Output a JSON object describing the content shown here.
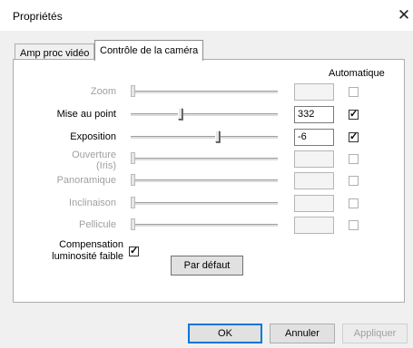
{
  "window": {
    "title": "Propriétés",
    "close_glyph": "✕"
  },
  "tabs": [
    {
      "label": "Amp proc vidéo",
      "active": false
    },
    {
      "label": "Contrôle de la caméra",
      "active": true
    }
  ],
  "auto_header": "Automatique",
  "rows": [
    {
      "label": "Zoom",
      "enabled": false,
      "value": "",
      "slider_fraction": 0.0,
      "auto_checked": false
    },
    {
      "label": "Mise au point",
      "enabled": true,
      "value": "332",
      "slider_fraction": 0.33,
      "auto_checked": true
    },
    {
      "label": "Exposition",
      "enabled": true,
      "value": "-6",
      "slider_fraction": 0.59,
      "auto_checked": true
    },
    {
      "label": "Ouverture\n(Iris)",
      "enabled": false,
      "value": "",
      "slider_fraction": 0.0,
      "auto_checked": false
    },
    {
      "label": "Panoramique",
      "enabled": false,
      "value": "",
      "slider_fraction": 0.0,
      "auto_checked": false
    },
    {
      "label": "Inclinaison",
      "enabled": false,
      "value": "",
      "slider_fraction": 0.0,
      "auto_checked": false
    },
    {
      "label": "Pellicule",
      "enabled": false,
      "value": "",
      "slider_fraction": 0.0,
      "auto_checked": false
    }
  ],
  "compensation": {
    "label": "Compensation\nluminosité faible",
    "checked": true
  },
  "buttons": {
    "default_label": "Par défaut",
    "ok_label": "OK",
    "cancel_label": "Annuler",
    "apply_label": "Appliquer",
    "apply_enabled": false
  },
  "glyphs": {
    "check": "✓"
  }
}
